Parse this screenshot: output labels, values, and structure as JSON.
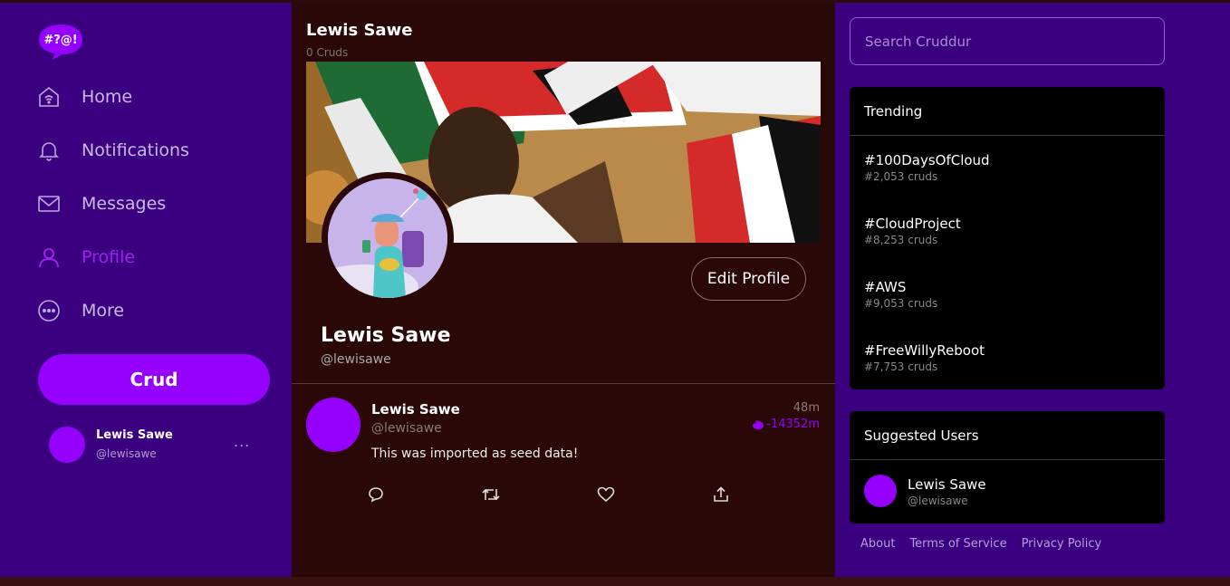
{
  "app": {
    "logo_text": "#?@!",
    "accent": "#9500ff",
    "sidebar_bg": "#3a0080",
    "content_bg": "#2a0808"
  },
  "nav": {
    "home": {
      "label": "Home",
      "icon": "home-icon"
    },
    "notifications": {
      "label": "Notifications",
      "icon": "bell-icon"
    },
    "messages": {
      "label": "Messages",
      "icon": "envelope-icon"
    },
    "profile": {
      "label": "Profile",
      "icon": "user-icon",
      "active": true
    },
    "more": {
      "label": "More",
      "icon": "more-circle-icon"
    }
  },
  "crud_button": "Crud",
  "current_user": {
    "name": "Lewis Sawe",
    "handle": "@lewisawe",
    "menu": "..."
  },
  "profile": {
    "header_title": "Lewis Sawe",
    "header_subtitle": "0 Cruds",
    "name": "Lewis Sawe",
    "handle": "@lewisawe",
    "edit_label": "Edit Profile"
  },
  "post": {
    "name": "Lewis Sawe",
    "handle": "@lewisawe",
    "time": "48m",
    "expires": "-14352m",
    "text": "This was imported as seed data!"
  },
  "search": {
    "placeholder": "Search Cruddur"
  },
  "trending": {
    "title": "Trending",
    "items": [
      {
        "tag": "#100DaysOfCloud",
        "count": "#2,053 cruds"
      },
      {
        "tag": "#CloudProject",
        "count": "#8,253 cruds"
      },
      {
        "tag": "#AWS",
        "count": "#9,053 cruds"
      },
      {
        "tag": "#FreeWillyReboot",
        "count": "#7,753 cruds"
      }
    ]
  },
  "suggested": {
    "title": "Suggested Users",
    "users": [
      {
        "name": "Lewis Sawe",
        "handle": "@lewisawe"
      }
    ]
  },
  "footer": {
    "about": "About",
    "terms": "Terms of Service",
    "privacy": "Privacy Policy"
  }
}
